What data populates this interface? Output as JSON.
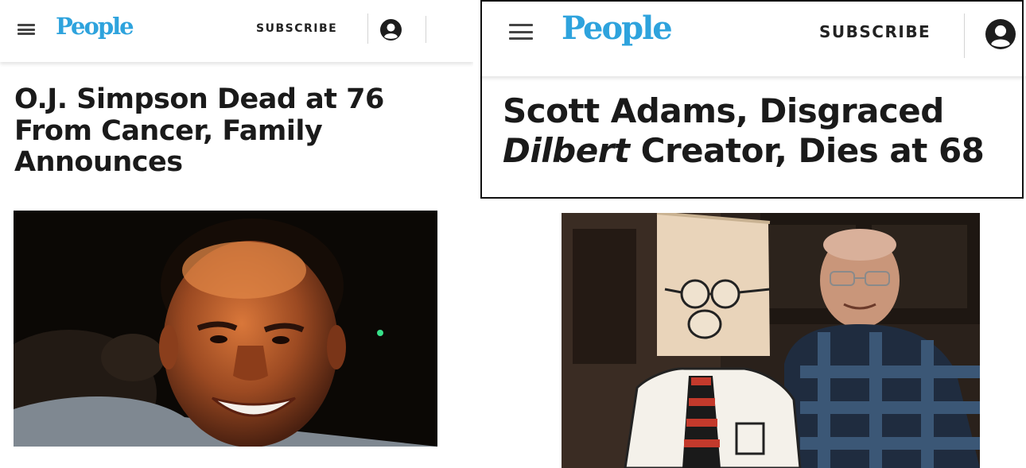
{
  "left_article": {
    "header": {
      "logo": "People",
      "subscribe": "SUBSCRIBE",
      "icons": [
        "menu-icon",
        "account-icon"
      ]
    },
    "headline": "O.J. Simpson Dead at 76 From Cancer, Family Announces"
  },
  "right_article": {
    "header": {
      "logo": "People",
      "subscribe": "SUBSCRIBE",
      "icons": [
        "menu-icon",
        "account-icon"
      ]
    },
    "headline_part1": "Scott Adams, Disgraced",
    "headline_italic": "Dilbert",
    "headline_part2": " Creator, Dies at 68"
  },
  "colors": {
    "logo": "#2ea3dd",
    "text": "#1a1a1a",
    "frame": "#111111"
  }
}
